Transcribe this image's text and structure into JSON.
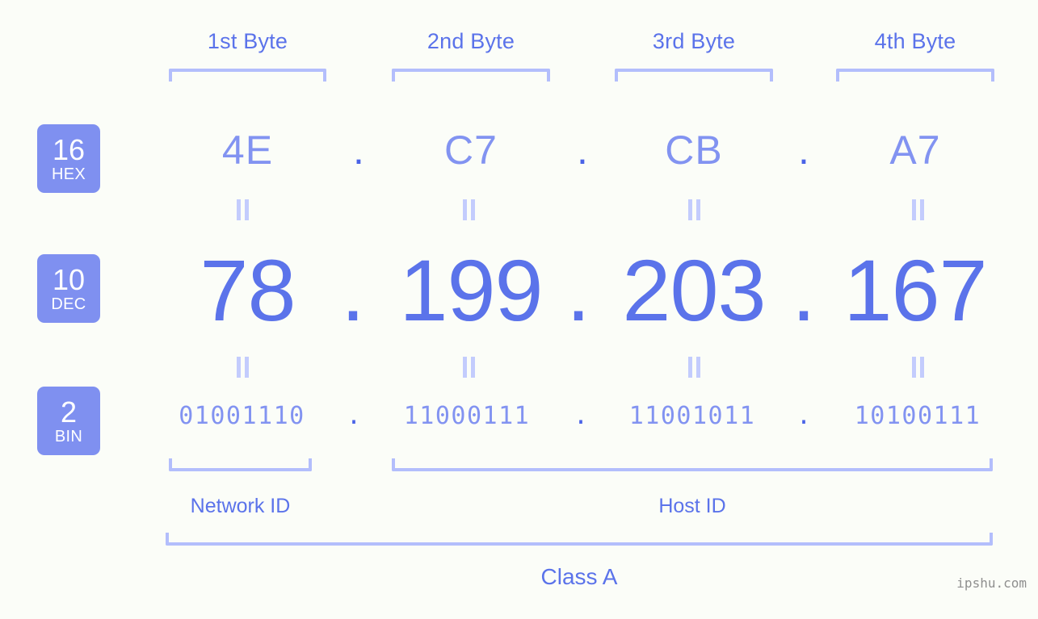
{
  "meta": {
    "ip_decimal": "78.199.203.167",
    "ip_hex": "4E.C7.CB.A7",
    "ip_binary": "01001110.11000111.11001011.10100111",
    "class": "Class A",
    "accent": "#5b73ea",
    "accent_light": "#8293f1",
    "bracket_color": "#b3befc",
    "badge_bg": "#7f90f0",
    "background": "#fbfdf8"
  },
  "byte_headers": [
    {
      "label": "1st Byte"
    },
    {
      "label": "2nd Byte"
    },
    {
      "label": "3rd Byte"
    },
    {
      "label": "4th Byte"
    }
  ],
  "radix_badges": [
    {
      "number": "16",
      "name": "HEX"
    },
    {
      "number": "10",
      "name": "DEC"
    },
    {
      "number": "2",
      "name": "BIN"
    }
  ],
  "rows": {
    "hex": {
      "radix_number": "16",
      "radix_name": "HEX",
      "octets": [
        "4E",
        "C7",
        "CB",
        "A7"
      ],
      "separators": [
        ".",
        ".",
        "."
      ]
    },
    "dec": {
      "radix_number": "10",
      "radix_name": "DEC",
      "octets": [
        "78",
        "199",
        "203",
        "167"
      ],
      "separators": [
        ".",
        ".",
        "."
      ]
    },
    "bin": {
      "radix_number": "2",
      "radix_name": "BIN",
      "octets": [
        "01001110",
        "11000111",
        "11001011",
        "10100111"
      ],
      "separators": [
        ".",
        ".",
        "."
      ]
    }
  },
  "equivalence_symbol": "=",
  "segments": {
    "network_id": "Network ID",
    "host_id": "Host ID",
    "class": "Class A"
  },
  "watermark": "ipshu.com"
}
